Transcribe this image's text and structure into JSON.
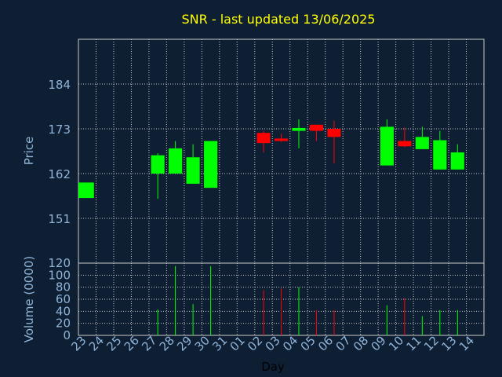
{
  "title": "SNR - last updated 13/06/2025",
  "colors": {
    "background": "#0f1f33",
    "title": "#ffff00",
    "axis_text": "#8fb4d8",
    "grid": "#c8c8c8",
    "up": "#00ff00",
    "down": "#ff0000"
  },
  "chart_data": [
    {
      "type": "candlestick",
      "title": "SNR - last updated 13/06/2025",
      "ylabel": "Price",
      "ylim": [
        140,
        195
      ],
      "yticks": [
        151,
        162,
        173,
        184
      ],
      "grid": true,
      "x": [
        "23",
        "24",
        "25",
        "26",
        "27",
        "28",
        "29",
        "30",
        "31",
        "01",
        "02",
        "03",
        "04",
        "05",
        "06",
        "07",
        "08",
        "09",
        "10",
        "11",
        "12",
        "13",
        "14"
      ],
      "candles": [
        {
          "day": "23",
          "open": 156.0,
          "high": 159.8,
          "low": 156.0,
          "close": 159.8,
          "dir": "up"
        },
        {
          "day": "27",
          "open": 162.0,
          "high": 167.0,
          "low": 155.8,
          "close": 166.5,
          "dir": "up"
        },
        {
          "day": "28",
          "open": 162.0,
          "high": 170.0,
          "low": 162.0,
          "close": 168.2,
          "dir": "up"
        },
        {
          "day": "29",
          "open": 159.5,
          "high": 169.2,
          "low": 159.5,
          "close": 166.0,
          "dir": "up"
        },
        {
          "day": "30",
          "open": 158.5,
          "high": 170.0,
          "low": 158.5,
          "close": 170.0,
          "dir": "up"
        },
        {
          "day": "02",
          "open": 172.0,
          "high": 172.5,
          "low": 167.2,
          "close": 169.5,
          "dir": "down"
        },
        {
          "day": "03",
          "open": 170.6,
          "high": 171.8,
          "low": 169.8,
          "close": 170.0,
          "dir": "down"
        },
        {
          "day": "04",
          "open": 172.5,
          "high": 175.3,
          "low": 168.2,
          "close": 173.2,
          "dir": "up"
        },
        {
          "day": "05",
          "open": 174.0,
          "high": 174.0,
          "low": 170.0,
          "close": 172.5,
          "dir": "down"
        },
        {
          "day": "06",
          "open": 173.0,
          "high": 175.0,
          "low": 164.5,
          "close": 171.0,
          "dir": "down"
        },
        {
          "day": "09",
          "open": 164.0,
          "high": 175.3,
          "low": 164.0,
          "close": 173.5,
          "dir": "up"
        },
        {
          "day": "10",
          "open": 170.0,
          "high": 173.3,
          "low": 168.5,
          "close": 168.7,
          "dir": "down"
        },
        {
          "day": "11",
          "open": 168.0,
          "high": 173.5,
          "low": 168.0,
          "close": 171.0,
          "dir": "up"
        },
        {
          "day": "12",
          "open": 163.0,
          "high": 172.5,
          "low": 163.0,
          "close": 170.2,
          "dir": "up"
        },
        {
          "day": "13",
          "open": 163.0,
          "high": 169.2,
          "low": 163.0,
          "close": 167.2,
          "dir": "up"
        }
      ]
    },
    {
      "type": "bar",
      "ylabel": "Volume (0000)",
      "xlabel": "Day",
      "ylim": [
        0,
        120
      ],
      "yticks": [
        0,
        20,
        40,
        60,
        80,
        100,
        120
      ],
      "grid": true,
      "categories": [
        "23",
        "27",
        "28",
        "29",
        "30",
        "02",
        "03",
        "04",
        "05",
        "06",
        "09",
        "10",
        "11",
        "12",
        "13"
      ],
      "values": [
        0,
        43,
        115,
        52,
        115,
        75,
        78,
        80,
        42,
        42,
        50,
        62,
        32,
        42,
        42
      ],
      "colors": [
        "up",
        "up",
        "up",
        "up",
        "up",
        "down",
        "down",
        "up",
        "down",
        "down",
        "up",
        "down",
        "up",
        "up",
        "up"
      ]
    }
  ]
}
